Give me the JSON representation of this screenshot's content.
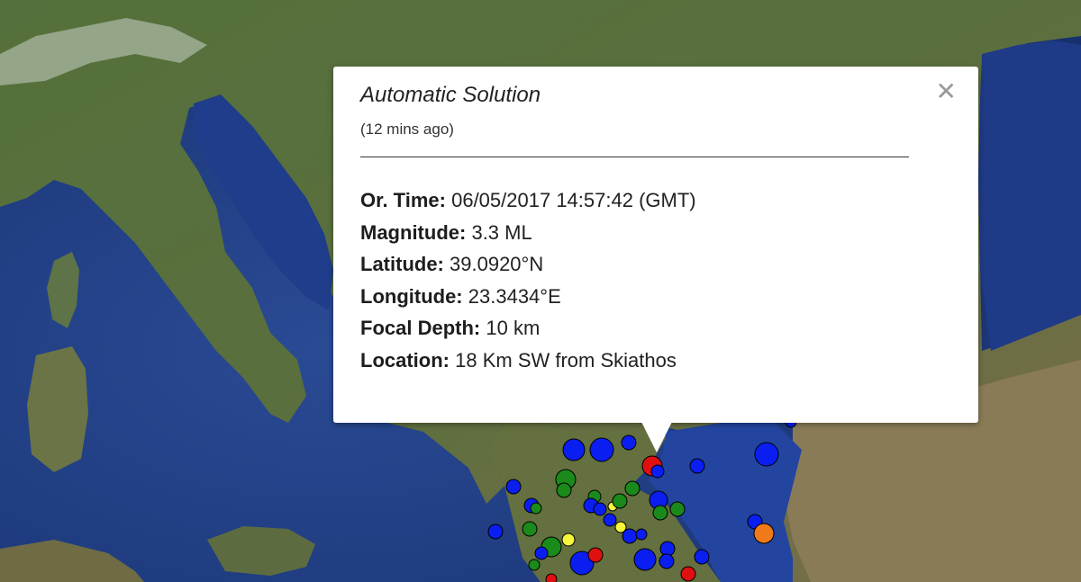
{
  "popup": {
    "title": "Automatic Solution",
    "subtitle": "(12 mins ago)",
    "close_icon": "close-icon",
    "fields": [
      {
        "label": "Or. Time:",
        "value": "06/05/2017  14:57:42 (GMT)"
      },
      {
        "label": "Magnitude:",
        "value": "3.3 ML"
      },
      {
        "label": "Latitude:",
        "value": "39.0920°N"
      },
      {
        "label": "Longitude:",
        "value": "23.3434°E"
      },
      {
        "label": "Focal Depth:",
        "value": "10 km"
      },
      {
        "label": "Location:",
        "value": "18 Km SW from Skiathos"
      }
    ]
  },
  "colors": {
    "sea": "#1f3f86",
    "land": "#4c6a34",
    "marker_blue": "#0b1ef2",
    "marker_green": "#1a8a1a",
    "marker_red": "#e01010",
    "marker_yellow": "#f5f53a",
    "marker_orange": "#f07a1a"
  }
}
